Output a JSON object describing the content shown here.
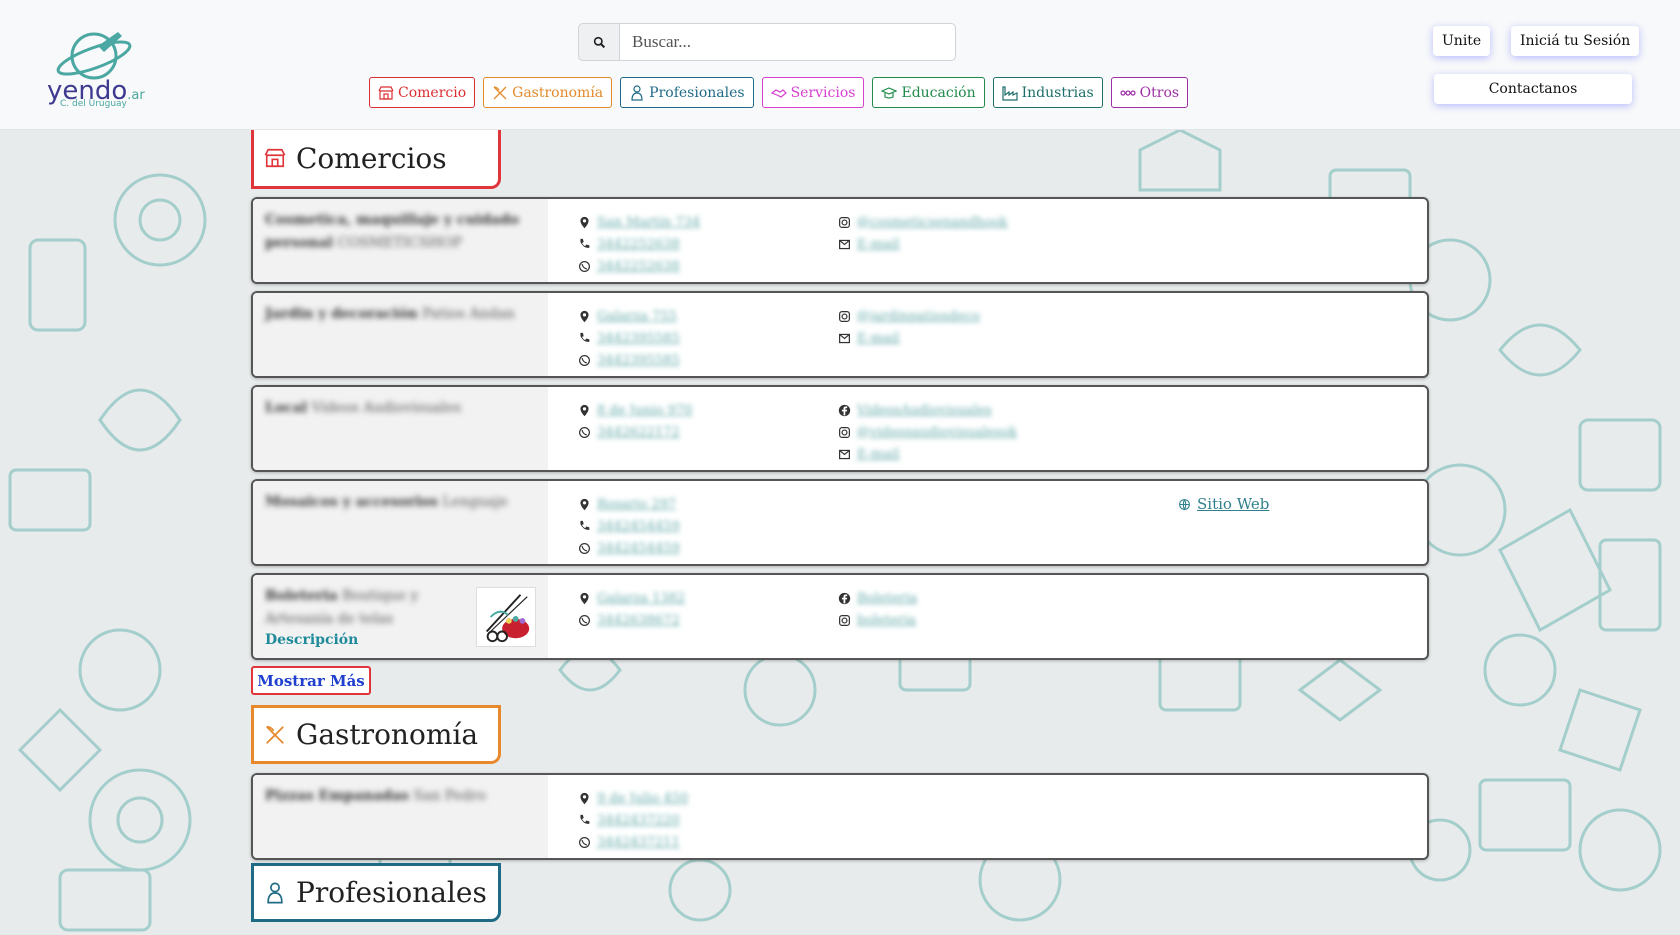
{
  "header": {
    "logo": {
      "name": "yendo",
      "suffix": ".ar",
      "subtitle": "C. del Uruguay"
    },
    "search_placeholder": "Buscar...",
    "categories": [
      {
        "label": "Comercio",
        "color": "#dc2d33"
      },
      {
        "label": "Gastronomía",
        "color": "#e38a2b"
      },
      {
        "label": "Profesionales",
        "color": "#1f6b86"
      },
      {
        "label": "Servicios",
        "color": "#d63fd0"
      },
      {
        "label": "Educación",
        "color": "#1f8a4a"
      },
      {
        "label": "Industrias",
        "color": "#1d6f6a"
      },
      {
        "label": "Otros",
        "color": "#9c2fa3"
      }
    ],
    "join_label": "Unite",
    "login_label": "Iniciá tu Sesión",
    "contact_label": "Contactanos"
  },
  "sections": {
    "comercios": {
      "title": "Comercios",
      "color": "#e0363b"
    },
    "gastronomia": {
      "title": "Gastronomía",
      "color": "#e8892e"
    },
    "profesionales": {
      "title": "Profesionales",
      "color": "#1f6b86"
    }
  },
  "cards": {
    "c1": {
      "name": "Cosmetica, maquillaje y cuidado personal",
      "extra": "COSMETICSHOP"
    },
    "c2": {
      "name": "Jardin y decoración",
      "extra": "Patios Andan"
    },
    "c3": {
      "name": "Local",
      "extra": "Videos Audiovisuales"
    },
    "c4": {
      "name": "Mosaicos y accesorios",
      "extra": "Lenguaje"
    },
    "c5": {
      "name": "Boleteria",
      "extra": "Boutique y Artesanía de telas"
    },
    "g1": {
      "name": "Pizzas Empanadas",
      "extra": "San Pedro"
    }
  },
  "site_link": "Sitio Web",
  "description_link": "Descripción",
  "show_more": "Mostrar Más",
  "colors": {
    "teal": "#4aa7a2",
    "accent_blue": "#1e3fcf"
  }
}
